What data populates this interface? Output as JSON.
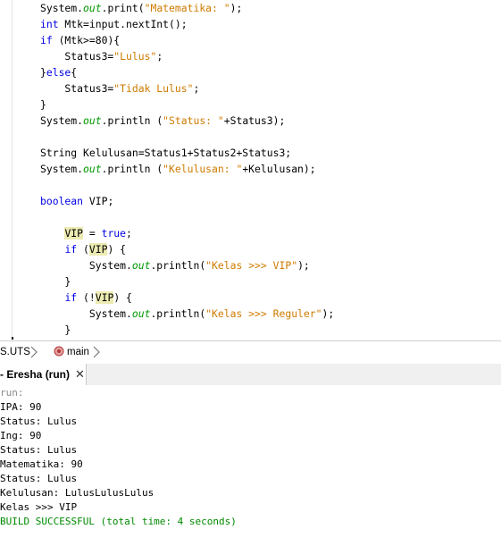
{
  "editor": {
    "lines": [
      {
        "parts": [
          {
            "t": "System.",
            "c": ""
          },
          {
            "t": "out",
            "c": "fld"
          },
          {
            "t": ".print(",
            "c": ""
          },
          {
            "t": "\"Matematika: \"",
            "c": "str"
          },
          {
            "t": ");",
            "c": ""
          }
        ]
      },
      {
        "parts": [
          {
            "t": "int",
            "c": "kw"
          },
          {
            "t": " Mtk=input.nextInt();",
            "c": ""
          }
        ]
      },
      {
        "parts": [
          {
            "t": "if",
            "c": "kw"
          },
          {
            "t": " (Mtk>=80){",
            "c": ""
          }
        ]
      },
      {
        "parts": [
          {
            "t": "    Status3=",
            "c": ""
          },
          {
            "t": "\"Lulus\"",
            "c": "str"
          },
          {
            "t": ";",
            "c": ""
          }
        ]
      },
      {
        "parts": [
          {
            "t": "}",
            "c": ""
          },
          {
            "t": "else",
            "c": "kw"
          },
          {
            "t": "{",
            "c": ""
          }
        ]
      },
      {
        "parts": [
          {
            "t": "    Status3=",
            "c": ""
          },
          {
            "t": "\"Tidak Lulus\"",
            "c": "str"
          },
          {
            "t": ";",
            "c": ""
          }
        ]
      },
      {
        "parts": [
          {
            "t": "}",
            "c": ""
          }
        ]
      },
      {
        "parts": [
          {
            "t": "System.",
            "c": ""
          },
          {
            "t": "out",
            "c": "fld"
          },
          {
            "t": ".println (",
            "c": ""
          },
          {
            "t": "\"Status: \"",
            "c": "str"
          },
          {
            "t": "+Status3);",
            "c": ""
          }
        ]
      },
      {
        "parts": []
      },
      {
        "parts": [
          {
            "t": "String Kelulusan=Status1+Status2+Status3;",
            "c": ""
          }
        ]
      },
      {
        "parts": [
          {
            "t": "System.",
            "c": ""
          },
          {
            "t": "out",
            "c": "fld"
          },
          {
            "t": ".println (",
            "c": ""
          },
          {
            "t": "\"Kelulusan: \"",
            "c": "str"
          },
          {
            "t": "+Kelulusan);",
            "c": ""
          }
        ]
      },
      {
        "parts": []
      },
      {
        "parts": [
          {
            "t": "boolean",
            "c": "kw"
          },
          {
            "t": " VIP;",
            "c": ""
          }
        ]
      },
      {
        "parts": []
      },
      {
        "parts": [
          {
            "t": "    ",
            "c": ""
          },
          {
            "t": "VIP",
            "c": "hl"
          },
          {
            "t": " = ",
            "c": ""
          },
          {
            "t": "true",
            "c": "kw"
          },
          {
            "t": ";",
            "c": ""
          }
        ]
      },
      {
        "parts": [
          {
            "t": "    ",
            "c": ""
          },
          {
            "t": "if",
            "c": "kw"
          },
          {
            "t": " (",
            "c": ""
          },
          {
            "t": "VIP",
            "c": "hl"
          },
          {
            "t": ") {",
            "c": ""
          }
        ]
      },
      {
        "parts": [
          {
            "t": "        System.",
            "c": ""
          },
          {
            "t": "out",
            "c": "fld"
          },
          {
            "t": ".println(",
            "c": ""
          },
          {
            "t": "\"Kelas >>> VIP\"",
            "c": "str"
          },
          {
            "t": ");",
            "c": ""
          }
        ]
      },
      {
        "parts": [
          {
            "t": "    }",
            "c": ""
          }
        ]
      },
      {
        "parts": [
          {
            "t": "    ",
            "c": ""
          },
          {
            "t": "if",
            "c": "kw"
          },
          {
            "t": " (!",
            "c": ""
          },
          {
            "t": "VIP",
            "c": "hl"
          },
          {
            "t": ") {",
            "c": ""
          }
        ]
      },
      {
        "parts": [
          {
            "t": "        System.",
            "c": ""
          },
          {
            "t": "out",
            "c": "fld"
          },
          {
            "t": ".println(",
            "c": ""
          },
          {
            "t": "\"Kelas >>> Reguler\"",
            "c": "str"
          },
          {
            "t": ");",
            "c": ""
          }
        ]
      },
      {
        "parts": [
          {
            "t": "    }",
            "c": ""
          }
        ]
      }
    ]
  },
  "breadcrumb": {
    "class_label": "S.UTS",
    "method_label": "main",
    "method_icon": "method-icon"
  },
  "output_tab": {
    "label": "- Eresha (run)",
    "close_glyph": "✕"
  },
  "console": {
    "lines": [
      {
        "text": "run:",
        "kind": "muted"
      },
      {
        "text": "IPA: 90",
        "kind": "normal"
      },
      {
        "text": "Status: Lulus",
        "kind": "normal"
      },
      {
        "text": "Ing: 90",
        "kind": "normal"
      },
      {
        "text": "Status: Lulus",
        "kind": "normal"
      },
      {
        "text": "Matematika: 90",
        "kind": "normal"
      },
      {
        "text": "Status: Lulus",
        "kind": "normal"
      },
      {
        "text": "Kelulusan: LulusLulusLulus",
        "kind": "normal"
      },
      {
        "text": "Kelas >>> VIP",
        "kind": "normal"
      },
      {
        "text": "BUILD SUCCESSFUL (total time: 4 seconds)",
        "kind": "ok"
      }
    ]
  },
  "colors": {
    "keyword": "#0000e6",
    "string": "#ce7b00",
    "field": "#009900",
    "occurrence_highlight": "#ecebb2",
    "build_success": "#008a00"
  }
}
